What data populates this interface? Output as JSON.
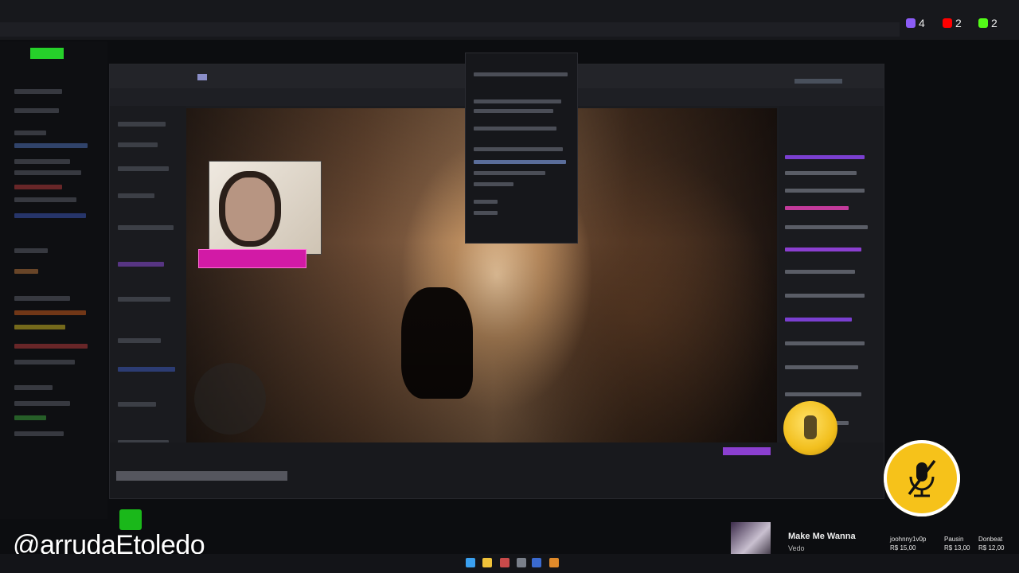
{
  "overlay": {
    "watermark": "@arrudaEtoledo",
    "counters": [
      {
        "icon": "twitch-icon",
        "value": "4",
        "color": "#8b5cf6"
      },
      {
        "icon": "youtube-icon",
        "value": "2",
        "color": "#ff0000"
      },
      {
        "icon": "kick-icon",
        "value": "2",
        "color": "#53fc18"
      }
    ],
    "mic_status_icon": "mic-muted-icon"
  },
  "now_playing": {
    "title": "Make Me Wanna",
    "artist": "Vedo"
  },
  "donors": [
    {
      "name": "joohnny1v0p",
      "amount": "R$ 15,00"
    },
    {
      "name": "Pausin",
      "amount": "R$ 13,00"
    },
    {
      "name": "Donbeat",
      "amount": "R$ 12,00"
    }
  ],
  "colors": {
    "accent_green": "#1ab81a",
    "accent_magenta": "#d21aa6",
    "mic_badge": "#f6c21a"
  }
}
